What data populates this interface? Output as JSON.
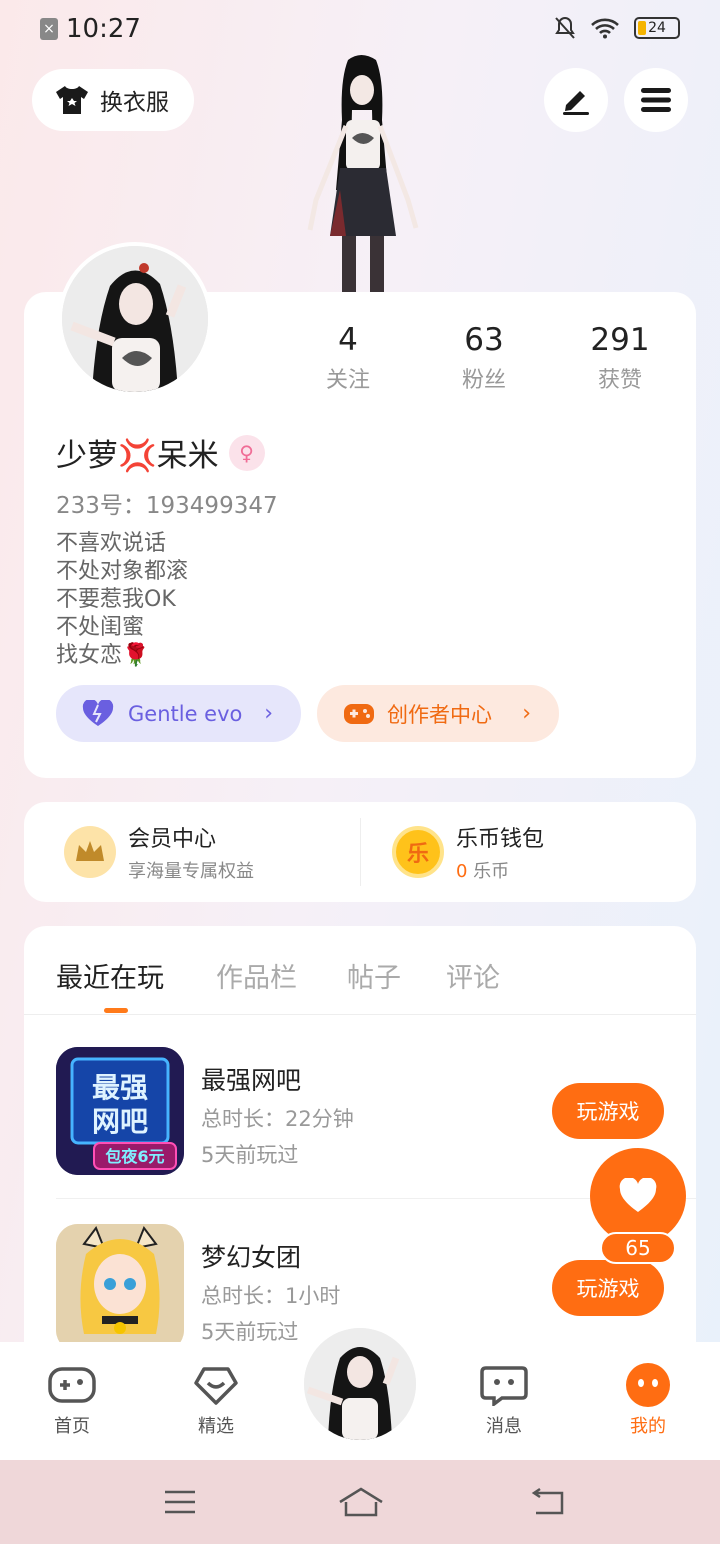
{
  "status_bar": {
    "time": "10:27",
    "battery": "24"
  },
  "top": {
    "wardrobe_label": "换衣服"
  },
  "stats": [
    {
      "num": "4",
      "label": "关注"
    },
    {
      "num": "63",
      "label": "粉丝"
    },
    {
      "num": "291",
      "label": "获赞"
    }
  ],
  "profile": {
    "name": "少萝💢呆米",
    "uid": "233号：193499347",
    "bio": [
      "不喜欢说话",
      "不处对象都滚",
      "不要惹我OK",
      "不处闺蜜",
      "找女恋🌹"
    ],
    "gentle_label": "Gentle evo",
    "creator_label": "创作者中心"
  },
  "wallet": {
    "vip_title": "会员中心",
    "vip_sub": "享海量专属权益",
    "coin_title": "乐币钱包",
    "coin_amount": "0",
    "coin_unit": " 乐币",
    "coin_glyph": "乐"
  },
  "tabs": [
    "最近在玩",
    "作品栏",
    "帖子",
    "评论"
  ],
  "games": [
    {
      "name": "最强网吧",
      "duration": "总时长：22分钟",
      "last": "5天前玩过",
      "button": "玩游戏",
      "icon_text_1": "最强",
      "icon_text_2": "网吧",
      "icon_badge": "包夜6元"
    },
    {
      "name": "梦幻女团",
      "duration": "总时长：1小时",
      "last": "5天前玩过",
      "button": "玩游戏"
    }
  ],
  "like_count": "65",
  "nav": [
    "首页",
    "精选",
    "消息",
    "我的"
  ],
  "colors": {
    "accent": "#ff6d12",
    "gentle": "#6a5fe0"
  }
}
